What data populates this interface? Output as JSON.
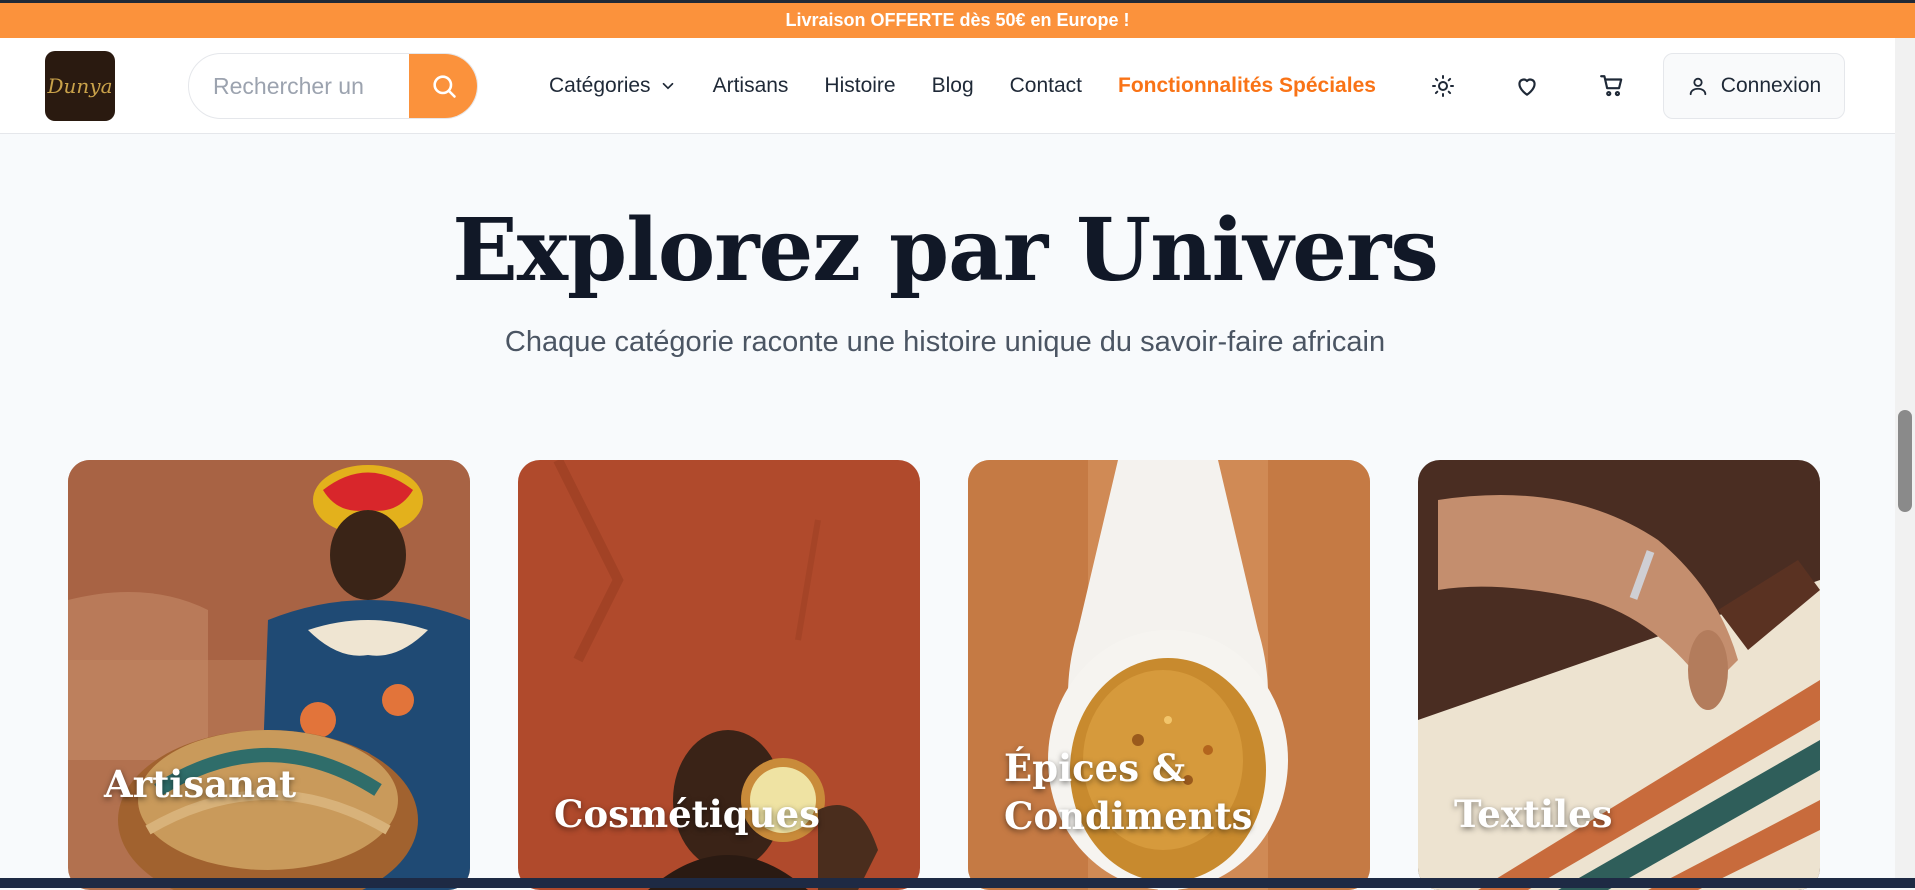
{
  "promo_banner": "Livraison OFFERTE dès 50€ en Europe !",
  "logo_text": "Dunya",
  "search": {
    "placeholder": "Rechercher un"
  },
  "nav": {
    "items": [
      "Catégories",
      "Artisans",
      "Histoire",
      "Blog",
      "Contact"
    ],
    "special": "Fonctionnalités Spéciales"
  },
  "header_icons": [
    "sun-icon",
    "heart-icon",
    "cart-icon"
  ],
  "login_label": "Connexion",
  "section": {
    "title": "Explorez par Univers",
    "subtitle": "Chaque catégorie raconte une histoire unique du savoir-faire africain"
  },
  "categories": [
    {
      "label": "Artisanat"
    },
    {
      "label": "Cosmétiques"
    },
    {
      "label": "Épices &",
      "label2": "Condiments"
    },
    {
      "label": "Textiles"
    }
  ],
  "colors": {
    "accent": "#fb923c",
    "special": "#f97316",
    "title": "#111827"
  }
}
